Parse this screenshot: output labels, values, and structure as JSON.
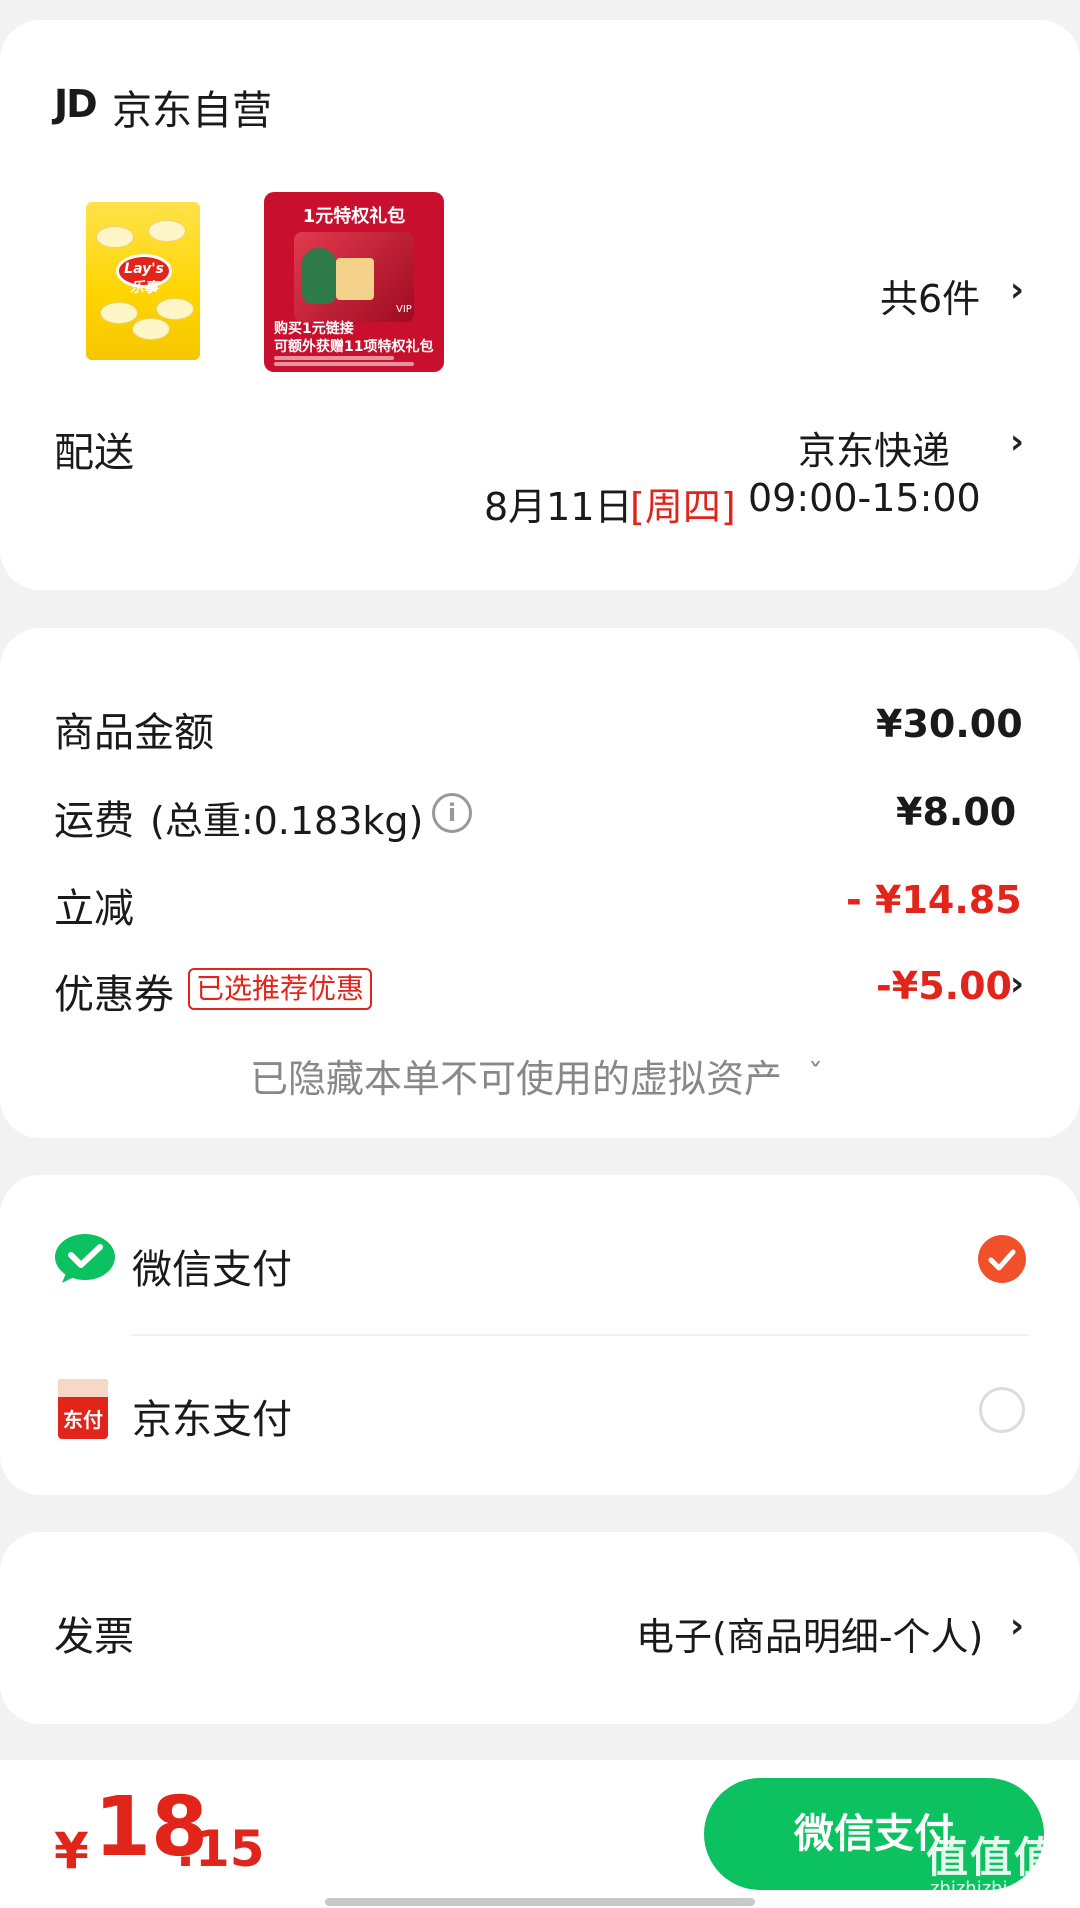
{
  "store": {
    "brand_mark": "JD",
    "name": "京东自营",
    "item_count": "共6件",
    "gift_thumb": {
      "title": "1元特权礼包",
      "line1": "购买1元链接",
      "line2": "可额外获赠11项特权礼包",
      "badge": "VIP"
    },
    "chips_thumb": {
      "brand": "Lay's乐事"
    },
    "delivery_label": "配送",
    "delivery_carrier": "京东快递",
    "delivery_date": "8月11日",
    "delivery_weekday": "[周四]",
    "delivery_time": "09:00-15:00"
  },
  "price": {
    "goods_label": "商品金额",
    "goods_value": "¥30.00",
    "shipping_label": "运费",
    "shipping_weight": "(总重:0.183kg)",
    "shipping_info_icon": "i",
    "shipping_value": "¥8.00",
    "discount_label": "立减",
    "discount_value": "- ¥14.85",
    "coupon_label": "优惠券",
    "coupon_tag": "已选推荐优惠",
    "coupon_value": "-¥5.00",
    "hidden_assets": "已隐藏本单不可使用的虚拟资产"
  },
  "payment": {
    "wechat_label": "微信支付",
    "wechat_selected": true,
    "jdpay_label": "京东支付",
    "jdpay_icon_text": "东付",
    "jdpay_selected": false
  },
  "invoice": {
    "label": "发票",
    "value": "电子(商品明细-个人)"
  },
  "bottom": {
    "currency": "¥",
    "total_int": "18",
    "total_dec": ".15",
    "pay_button": "微信支付",
    "watermark": "值值值",
    "watermark_sub": "zhizhizhi.com"
  },
  "colors": {
    "accent_red": "#e1251b",
    "wechat_green": "#0bc160",
    "radio_orange": "#f2502a"
  },
  "icons": {
    "chevron": "›",
    "chevron_down": "ˇ"
  }
}
